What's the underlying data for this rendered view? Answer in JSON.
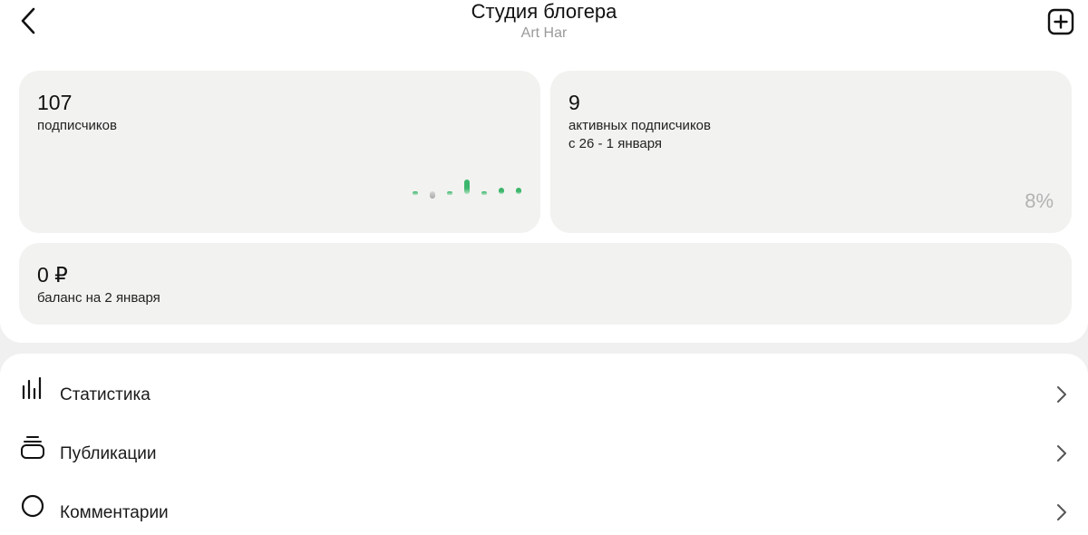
{
  "header": {
    "title": "Студия блогера",
    "subtitle": "Art Har"
  },
  "icons": {
    "back": "chevron-left-icon",
    "add": "plus-square-icon",
    "stats": "bar-chart-icon",
    "publications": "stack-icon",
    "comments": "chat-bubble-icon",
    "chevron": "chevron-right-icon"
  },
  "colors": {
    "accent_green": "#3cb66c",
    "faded_green": "#b7e3c6",
    "card_bg": "#f2f2f0"
  },
  "cards": {
    "subscribers": {
      "value": "107",
      "label": "подписчиков",
      "sparkline": [
        {
          "value": 0,
          "color": "green"
        },
        {
          "value": -1,
          "color": "gray"
        },
        {
          "value": 0,
          "color": "green"
        },
        {
          "value": 3,
          "color": "green"
        },
        {
          "value": 0,
          "color": "green"
        },
        {
          "value": 1,
          "color": "green"
        },
        {
          "value": 1,
          "color": "green"
        }
      ]
    },
    "active": {
      "value": "9",
      "label_line1": "активных подписчиков",
      "label_line2": "с 26 - 1 января",
      "percent": "8%"
    },
    "balance": {
      "value": "0 ₽",
      "label": "баланс на 2 января"
    }
  },
  "menu": {
    "items": [
      {
        "label": "Статистика"
      },
      {
        "label": "Публикации"
      },
      {
        "label": "Комментарии"
      }
    ]
  }
}
